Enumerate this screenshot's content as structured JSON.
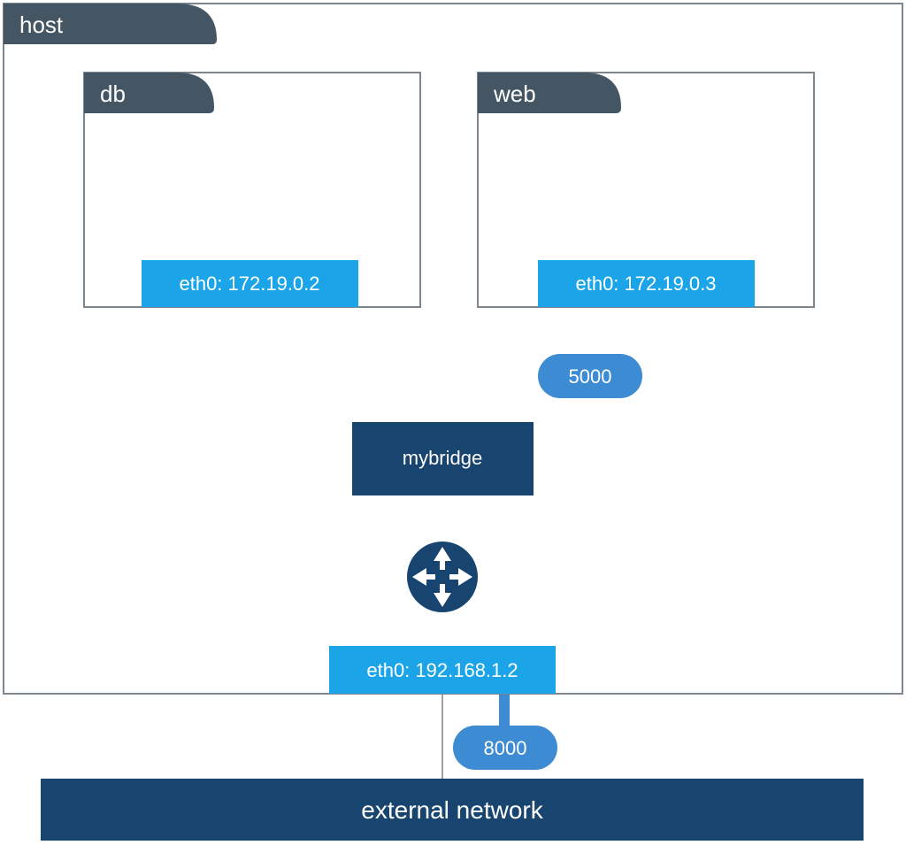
{
  "host": {
    "label": "host",
    "eth": "eth0: 192.168.1.2"
  },
  "containers": {
    "db": {
      "label": "db",
      "eth": "eth0: 172.19.0.2"
    },
    "web": {
      "label": "web",
      "eth": "eth0: 172.19.0.3",
      "port": "5000"
    }
  },
  "bridge": {
    "label": "mybridge"
  },
  "external": {
    "label": "external network",
    "port": "8000"
  },
  "colors": {
    "tab": "#445663",
    "border": "#7b868f",
    "ethBox": "#1ba5e8",
    "portPill": "#3c8bd3",
    "bridgeBox": "#17456f",
    "routerCircle": "#17456f",
    "extBar": "#17456f",
    "thickStroke": "#3c8bd3"
  }
}
